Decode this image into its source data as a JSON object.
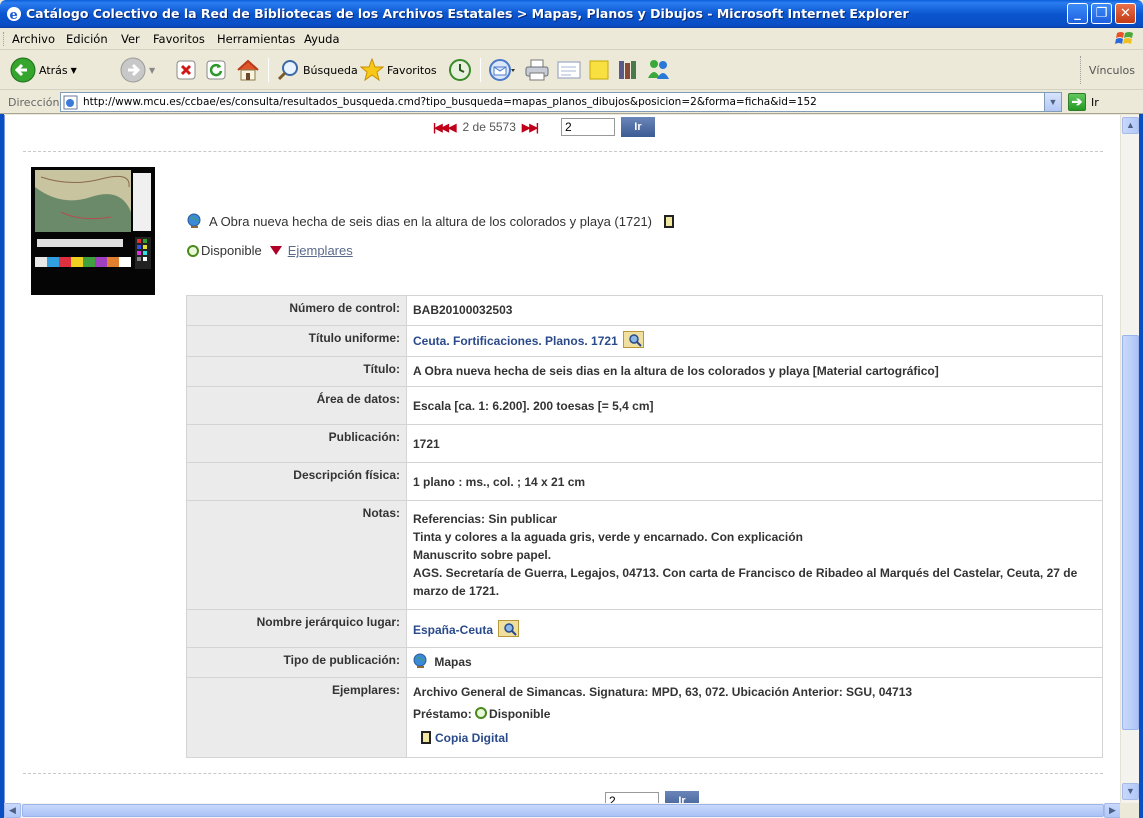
{
  "window": {
    "title": "Catálogo Colectivo de la Red de Bibliotecas de los Archivos Estatales > Mapas, Planos y Dibujos - Microsoft Internet Explorer"
  },
  "menu": [
    {
      "label": "Archivo"
    },
    {
      "label": "Edición"
    },
    {
      "label": "Ver"
    },
    {
      "label": "Favoritos"
    },
    {
      "label": "Herramientas"
    },
    {
      "label": "Ayuda"
    }
  ],
  "toolbar": {
    "back_label": "Atrás",
    "search_label": "Búsqueda",
    "favorites_label": "Favoritos",
    "links_label": "Vínculos"
  },
  "address": {
    "label": "Dirección",
    "url": "http://www.mcu.es/ccbae/es/consulta/resultados_busqueda.cmd?tipo_busqueda=mapas_planos_dibujos&posicion=2&forma=ficha&id=152",
    "go_label": "Ir"
  },
  "pager": {
    "position_text": "2 de 5573",
    "input_value": "2",
    "go_label": "Ir"
  },
  "record": {
    "title": "A Obra nueva hecha de seis dias en la altura de los colorados y playa (1721)",
    "availability": "Disponible",
    "copies_link": "Ejemplares"
  },
  "details": {
    "control_key": "Número de control:",
    "control_val": "BAB20100032503",
    "uniform_key": "Título uniforme:",
    "uniform_val": "Ceuta. Fortificaciones. Planos. 1721",
    "title_key": "Título:",
    "title_val": "A Obra nueva hecha de seis dias en la altura de los colorados y playa [Material cartográfico]",
    "area_key": "Área de datos:",
    "area_val": "Escala [ca. 1: 6.200]. 200 toesas [= 5,4 cm]",
    "pub_key": "Publicación:",
    "pub_val": "1721",
    "phys_key": "Descripción física:",
    "phys_val": "1 plano : ms., col. ; 14 x 21 cm",
    "notes_key": "Notas:",
    "notes": [
      "Referencias: Sin publicar",
      "Tinta y colores a la aguada gris, verde y encarnado. Con explicación",
      "Manuscrito sobre papel.",
      "AGS. Secretaría de Guerra, Legajos, 04713. Con carta de Francisco de Ribadeo al Marqués del Castelar, Ceuta, 27 de marzo de 1721."
    ],
    "place_key": "Nombre jerárquico lugar:",
    "place_val": "España-Ceuta",
    "type_key": "Tipo de publicación:",
    "type_val": "Mapas",
    "copies_key": "Ejemplares:",
    "copies_val": "Archivo General de Simancas. Signatura: MPD, 63, 072. Ubicación Anterior: SGU, 04713",
    "loan_label": "Préstamo:",
    "loan_val": "Disponible",
    "digital_copy": "Copia Digital"
  }
}
